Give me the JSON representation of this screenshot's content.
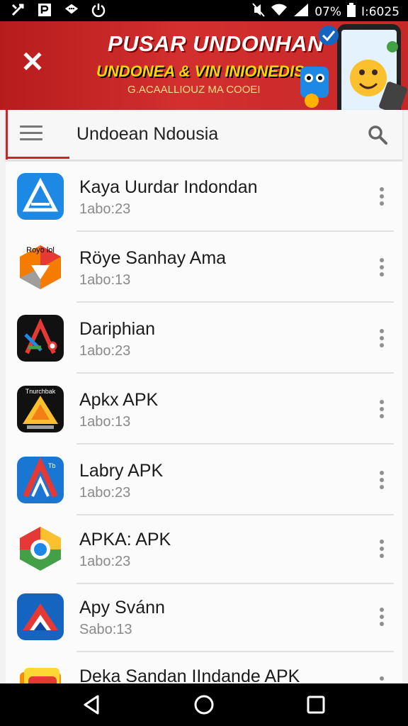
{
  "status_bar": {
    "battery": "07%",
    "time": "I:6025",
    "icons": [
      "tools-icon",
      "p-square-icon",
      "message-icon",
      "power-icon",
      "mute-icon",
      "wifi-icon",
      "signal-icon",
      "battery-icon"
    ]
  },
  "banner": {
    "title": "PUSAR UNDONHAN",
    "subtitle": "UNDONEA & VIN INIONEDIS",
    "tagline": "G.ACAALLIOUZ MA COOEI",
    "bg_color": "#d32f2f",
    "subtitle_color": "#ffd600"
  },
  "toolbar": {
    "title": "Undoean Ndousia",
    "accent_color": "#c62828"
  },
  "apps": [
    {
      "name": "Kaya Uurdar Indondan",
      "meta": "1abo:23",
      "icon": "blue-a-icon"
    },
    {
      "name": "Röye Sanhay Ama",
      "meta": "1abo:13",
      "icon": "orange-hexagon-icon",
      "icon_caption": "Royo lol"
    },
    {
      "name": "Dariphian",
      "meta": "1abo:23",
      "icon": "black-a-icon"
    },
    {
      "name": "Apkx APK",
      "meta": "1abo:13",
      "icon": "yellow-triangle-icon",
      "icon_caption": "Tnurchbak"
    },
    {
      "name": "Labry APK",
      "meta": "1abo:23",
      "icon": "blue-red-a-icon",
      "icon_caption": "Tb"
    },
    {
      "name": "APKA: APK",
      "meta": "1abo:23",
      "icon": "green-hexagon-icon"
    },
    {
      "name": "Apy Svánn",
      "meta": "Sabo:13",
      "icon": "blue-red-chevron-icon"
    },
    {
      "name": "Deka Sandan IIndande APK",
      "meta": "",
      "icon": "folder-stack-icon"
    }
  ]
}
